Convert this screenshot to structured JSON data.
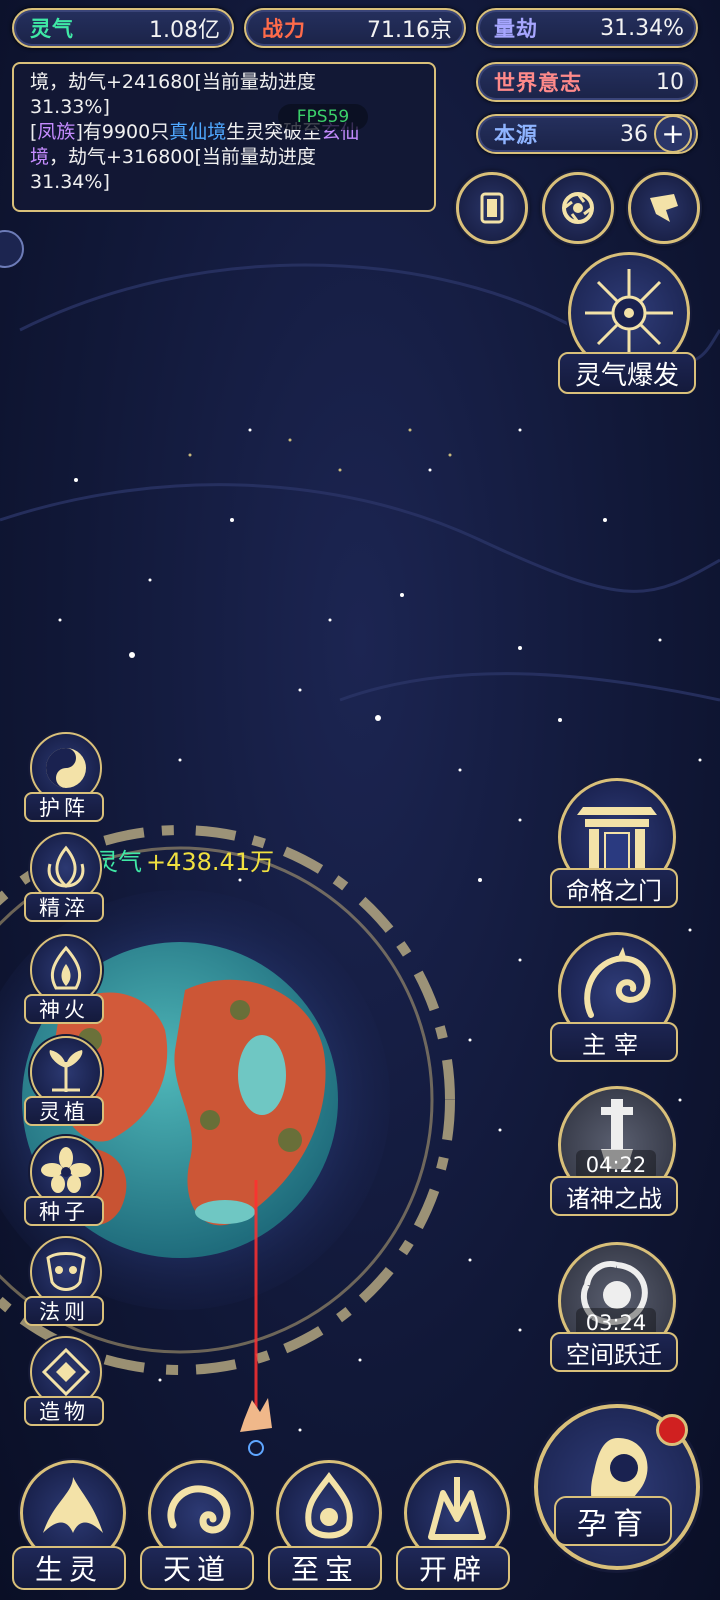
{
  "stats": {
    "lingqi": {
      "label": "灵气",
      "value": "1.08亿"
    },
    "zhanli": {
      "label": "战力",
      "value": "71.16京"
    },
    "liangjie": {
      "label": "量劫",
      "value": "31.34%"
    },
    "shijie": {
      "label": "世界意志",
      "value": "10"
    },
    "benyuan": {
      "label": "本源",
      "value": "36"
    }
  },
  "log": {
    "line1": "境，劫气+241680[当前量劫进度",
    "line2": "31.33%]",
    "line3_a": "[",
    "line3_clan": "凤族",
    "line3_b": "]有9900只",
    "line3_realm1": "真仙境",
    "line3_c": "生灵突破至",
    "line3_realm2": "玄仙",
    "line4_realm2b": "境",
    "line4_rest": "，劫气+316800[当前量劫进度",
    "line5": "31.34%]",
    "fps": "FPS59"
  },
  "side_left": [
    "护阵",
    "精淬",
    "神火",
    "灵植",
    "种子",
    "法则",
    "造物"
  ],
  "float_gain": {
    "label": "灵气",
    "value": "+438.41万"
  },
  "right": {
    "burst": "灵气爆发",
    "mingge": "命格之门",
    "zhuzai": "主宰",
    "zhushen": {
      "label": "诸神之战",
      "timer": "04:22"
    },
    "kongjian": {
      "label": "空间跃迁",
      "timer": "03:24"
    },
    "yunyu": "孕育"
  },
  "bottom": [
    "生灵",
    "天道",
    "至宝",
    "开辟"
  ],
  "colors": {
    "gold": "#d9c07a",
    "lingqi_label": "#3fe9a6",
    "zhanli_label": "#ff6b4a",
    "liangjie_label": "#a7a6ff",
    "shijie_label": "#ff8a8a",
    "benyuan_label": "#8fb4ff",
    "clan": "#c58cff",
    "realm": "#4fa8ff",
    "gain": "#f0e040"
  }
}
